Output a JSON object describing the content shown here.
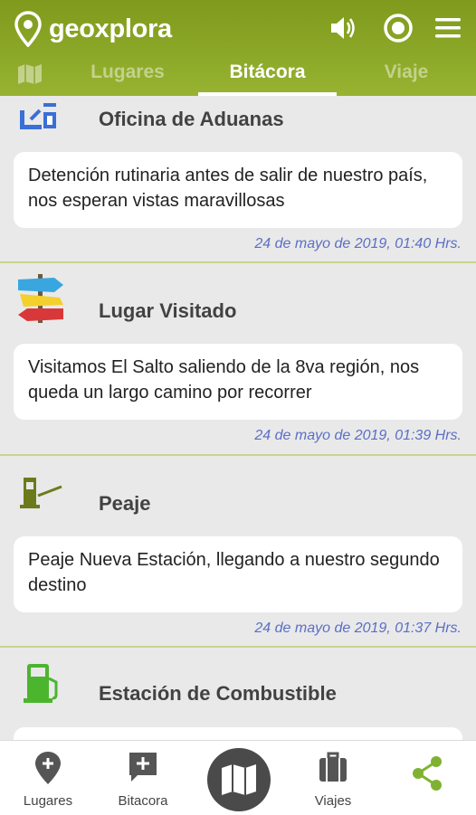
{
  "app": {
    "title": "geoxplora"
  },
  "header": {
    "icons": [
      "pin-logo-icon",
      "volume-icon",
      "record-icon",
      "menu-icon"
    ],
    "tabs": [
      {
        "label": "",
        "icon": "map-icon"
      },
      {
        "label": "Lugares"
      },
      {
        "label": "Bitácora",
        "active": true
      },
      {
        "label": "Viaje"
      }
    ]
  },
  "entries": [
    {
      "title": "Oficina de Aduanas",
      "icon": "customs-office-icon",
      "text": "Detención rutinaria antes de salir de nuestro país, nos esperan vistas maravillosas",
      "timestamp": "24 de mayo de 2019, 01:40 Hrs."
    },
    {
      "title": "Lugar Visitado",
      "icon": "signpost-icon",
      "text": "Visitamos El Salto saliendo de la 8va región, nos queda un largo camino por recorrer",
      "timestamp": "24 de mayo de 2019, 01:39 Hrs."
    },
    {
      "title": "Peaje",
      "icon": "toll-booth-icon",
      "text": "Peaje Nueva Estación, llegando a nuestro segundo destino",
      "timestamp": "24 de mayo de 2019, 01:37 Hrs."
    },
    {
      "title": "Estación de Combustible",
      "icon": "fuel-station-icon",
      "text": "",
      "timestamp": ""
    }
  ],
  "bottom_nav": [
    {
      "label": "Lugares",
      "icon": "add-place-icon"
    },
    {
      "label": "Bitacora",
      "icon": "add-comment-icon"
    },
    {
      "label": "",
      "icon": "map-icon"
    },
    {
      "label": "Viajes",
      "icon": "luggage-icon"
    },
    {
      "label": "",
      "icon": "share-icon"
    }
  ],
  "colors": {
    "header_green": "#8aa52a",
    "accent_green": "#7fb231",
    "timestamp_blue": "#5b6fc5",
    "divider": "#c8d48f",
    "background": "#e9e9e9"
  }
}
